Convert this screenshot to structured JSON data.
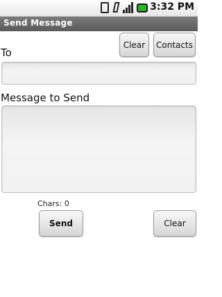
{
  "status_bar": {
    "time": "3:32 PM",
    "icons": [
      "sd-card-icon",
      "vibrate-icon",
      "signal-icon",
      "battery-icon"
    ],
    "battery_color": "#2bb52b"
  },
  "app": {
    "title": "Send Message"
  },
  "toolbar": {
    "clear_label": "Clear",
    "contacts_label": "Contacts"
  },
  "form": {
    "to_label": "To",
    "to_value": "",
    "message_label": "Message to Send",
    "message_value": "",
    "chars_text": "Chars: 0"
  },
  "actions": {
    "send_label": "Send",
    "clear_label": "Clear"
  }
}
